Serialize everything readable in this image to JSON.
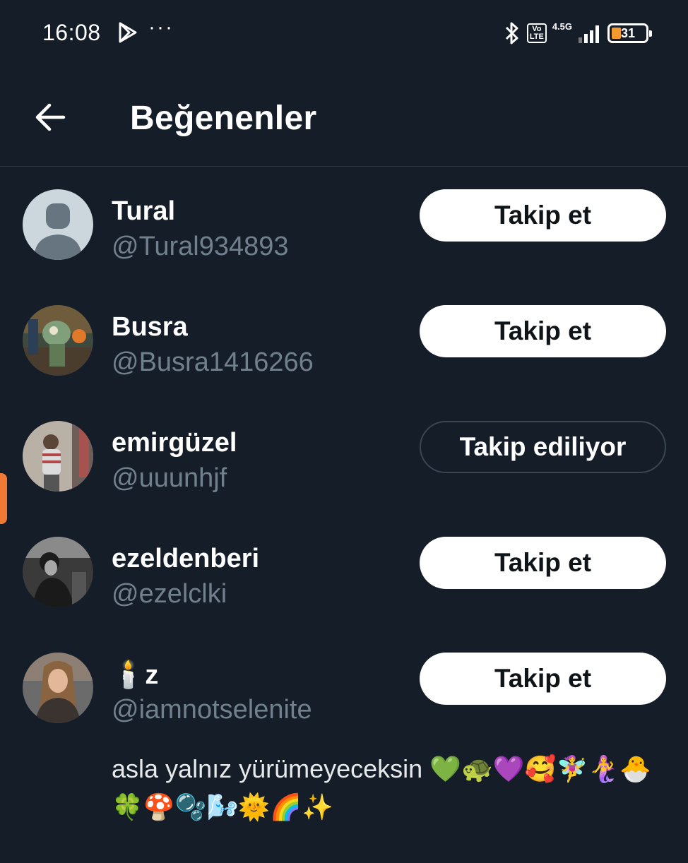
{
  "status_bar": {
    "time": "16:08",
    "dots": "···",
    "volte": "Vo\nLTE",
    "network": "4.5G",
    "battery": "31",
    "battery_color": "#f29a2e"
  },
  "header": {
    "title": "Beğenenler"
  },
  "users": [
    {
      "name": "Tural",
      "handle": "@Tural934893",
      "button": "Takip et",
      "following": false,
      "avatar": "default-avatar"
    },
    {
      "name": "Busra",
      "handle": "@Busra1416266",
      "button": "Takip et",
      "following": false,
      "avatar": "photo-avatar"
    },
    {
      "name": "emirgüzel",
      "handle": "@uuunhjf",
      "button": "Takip ediliyor",
      "following": true,
      "avatar": "photo-avatar"
    },
    {
      "name": "ezeldenberi",
      "handle": "@ezelclki",
      "button": "Takip et",
      "following": false,
      "avatar": "photo-avatar"
    },
    {
      "name": "🕯️z",
      "handle": "@iamnotselenite",
      "button": "Takip et",
      "following": false,
      "avatar": "photo-avatar",
      "bio": "asla yalnız yürümeyeceksin 💚🐢💜🥰🧚‍♀️🧜‍♀️🐣🍀🍄🫧🌬️🌞🌈✨"
    }
  ],
  "colors": {
    "background": "#151d28",
    "handle": "#71808d",
    "accent_tab": "#f07a35"
  }
}
